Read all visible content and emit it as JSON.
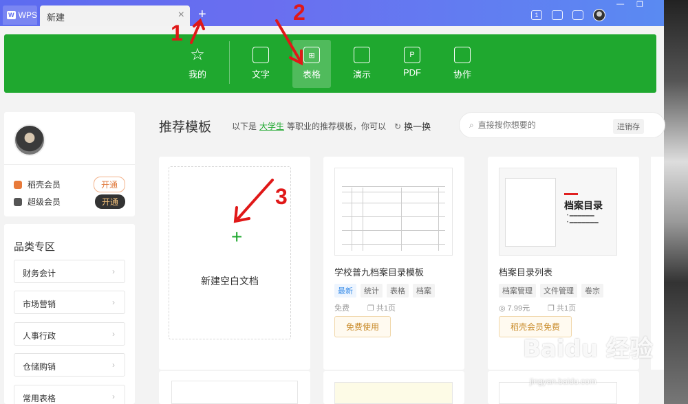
{
  "titlebar": {
    "app_label": "WPS",
    "tab_label": "新建",
    "tab_close": "×",
    "new_tab": "+",
    "page_num_badge": "1"
  },
  "nav": {
    "items": [
      {
        "label": "我的",
        "icon": "star-icon"
      },
      {
        "label": "文字",
        "icon": "document-icon"
      },
      {
        "label": "表格",
        "icon": "spreadsheet-icon"
      },
      {
        "label": "演示",
        "icon": "presentation-icon"
      },
      {
        "label": "PDF",
        "icon": "pdf-icon"
      },
      {
        "label": "协作",
        "icon": "collaborate-icon"
      }
    ],
    "active": "表格"
  },
  "profile": {
    "members": [
      {
        "name": "稻壳会员",
        "action": "开通",
        "color": "#e87a3a"
      },
      {
        "name": "超级会员",
        "action": "开通",
        "color": "#555555"
      }
    ]
  },
  "categories": {
    "title": "品类专区",
    "items": [
      "财务会计",
      "市场营销",
      "人事行政",
      "仓储购销",
      "常用表格"
    ]
  },
  "main": {
    "title": "推荐模板",
    "sub_prefix": "以下是",
    "sub_highlight": "大学生",
    "sub_suffix": "等职业的推荐模板，你可以",
    "swap": "换一换"
  },
  "search": {
    "placeholder": "直接搜你想要的",
    "tag": "进销存"
  },
  "blank_card": {
    "label": "新建空白文档"
  },
  "templates": [
    {
      "title": "学校普九档案目录模板",
      "tags": [
        "最新",
        "统计",
        "表格",
        "档案"
      ],
      "price": "免费",
      "pages": "共1页",
      "action": "免费使用"
    },
    {
      "title": "档案目录列表",
      "tags": [
        "档案管理",
        "文件管理",
        "卷宗"
      ],
      "price": "7.99元",
      "pages": "共1页",
      "action": "稻壳会员免费",
      "thumb_title": "档案目录"
    }
  ],
  "annotations": [
    "1",
    "2",
    "3"
  ],
  "watermark": {
    "text": "Baidu 经验",
    "url": "jingyan.baidu.com"
  },
  "colors": {
    "accent": "#1fa82f",
    "titlebar": "#5c6cf0",
    "annotation": "#e01818"
  }
}
